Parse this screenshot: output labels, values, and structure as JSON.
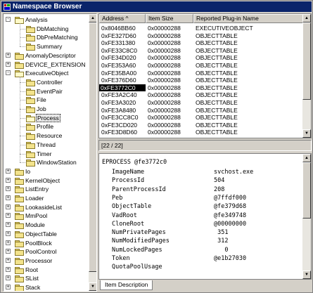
{
  "window": {
    "title": "Namespace Browser"
  },
  "tree": {
    "items": [
      {
        "label": "Analysis",
        "depth": 0,
        "expander": "-",
        "icon": "folder-open"
      },
      {
        "label": "DbMatching",
        "depth": 1,
        "expander": "",
        "icon": "folder"
      },
      {
        "label": "DbPreMatching",
        "depth": 1,
        "expander": "",
        "icon": "folder"
      },
      {
        "label": "Summary",
        "depth": 1,
        "expander": "",
        "icon": "folder"
      },
      {
        "label": "AnomalyDescriptor",
        "depth": 0,
        "expander": "+",
        "icon": "folder"
      },
      {
        "label": "DEVICE_EXTENSION",
        "depth": 0,
        "expander": "+",
        "icon": "folder"
      },
      {
        "label": "ExecutiveObject",
        "depth": 0,
        "expander": "-",
        "icon": "folder-open"
      },
      {
        "label": "Controller",
        "depth": 1,
        "expander": "",
        "icon": "folder"
      },
      {
        "label": "EventPair",
        "depth": 1,
        "expander": "",
        "icon": "folder"
      },
      {
        "label": "File",
        "depth": 1,
        "expander": "",
        "icon": "folder"
      },
      {
        "label": "Job",
        "depth": 1,
        "expander": "",
        "icon": "folder"
      },
      {
        "label": "Process",
        "depth": 1,
        "expander": "",
        "icon": "folder-open",
        "selected": true
      },
      {
        "label": "Profile",
        "depth": 1,
        "expander": "",
        "icon": "folder"
      },
      {
        "label": "Resource",
        "depth": 1,
        "expander": "",
        "icon": "folder"
      },
      {
        "label": "Thread",
        "depth": 1,
        "expander": "",
        "icon": "folder"
      },
      {
        "label": "Timer",
        "depth": 1,
        "expander": "",
        "icon": "folder"
      },
      {
        "label": "WindowStation",
        "depth": 1,
        "expander": "",
        "icon": "folder"
      },
      {
        "label": "Io",
        "depth": 0,
        "expander": "+",
        "icon": "folder"
      },
      {
        "label": "KernelObject",
        "depth": 0,
        "expander": "+",
        "icon": "folder"
      },
      {
        "label": "ListEntry",
        "depth": 0,
        "expander": "+",
        "icon": "folder"
      },
      {
        "label": "Loader",
        "depth": 0,
        "expander": "+",
        "icon": "folder"
      },
      {
        "label": "LookasideList",
        "depth": 0,
        "expander": "+",
        "icon": "folder"
      },
      {
        "label": "MmPool",
        "depth": 0,
        "expander": "+",
        "icon": "folder"
      },
      {
        "label": "Module",
        "depth": 0,
        "expander": "+",
        "icon": "folder"
      },
      {
        "label": "ObjectTable",
        "depth": 0,
        "expander": "+",
        "icon": "folder"
      },
      {
        "label": "PoolBlock",
        "depth": 0,
        "expander": "+",
        "icon": "folder"
      },
      {
        "label": "PoolControl",
        "depth": 0,
        "expander": "+",
        "icon": "folder"
      },
      {
        "label": "Processor",
        "depth": 0,
        "expander": "+",
        "icon": "folder"
      },
      {
        "label": "Root",
        "depth": 0,
        "expander": "+",
        "icon": "folder"
      },
      {
        "label": "SList",
        "depth": 0,
        "expander": "+",
        "icon": "folder"
      },
      {
        "label": "Stack",
        "depth": 0,
        "expander": "+",
        "icon": "folder"
      }
    ]
  },
  "list": {
    "columns": [
      "Address  ^",
      "Item Size",
      "Reported Plug-in Name"
    ],
    "rows": [
      [
        "0x8046BB60",
        "0x00000288",
        "EXECUTIVEOBJECT"
      ],
      [
        "0xFE327D60",
        "0x00000288",
        "OBJECTTABLE"
      ],
      [
        "0xFE331380",
        "0x00000288",
        "OBJECTTABLE"
      ],
      [
        "0xFE33C8C0",
        "0x00000288",
        "OBJECTTABLE"
      ],
      [
        "0xFE34D020",
        "0x00000288",
        "OBJECTTABLE"
      ],
      [
        "0xFE353A60",
        "0x00000288",
        "OBJECTTABLE"
      ],
      [
        "0xFE35BA00",
        "0x00000288",
        "OBJECTTABLE"
      ],
      [
        "0xFE376D60",
        "0x00000288",
        "OBJECTTABLE"
      ],
      [
        "0xFE3772C0",
        "0x00000288",
        "OBJECTTABLE"
      ],
      [
        "0xFE3A2C40",
        "0x00000288",
        "OBJECTTABLE"
      ],
      [
        "0xFE3A3020",
        "0x00000288",
        "OBJECTTABLE"
      ],
      [
        "0xFE3A8480",
        "0x00000288",
        "OBJECTTABLE"
      ],
      [
        "0xFE3CC8C0",
        "0x00000288",
        "OBJECTTABLE"
      ],
      [
        "0xFE3CD020",
        "0x00000288",
        "OBJECTTABLE"
      ],
      [
        "0xFE3D8D60",
        "0x00000288",
        "OBJECTTABLE"
      ]
    ],
    "selected_index": 8
  },
  "status": {
    "text": "[22 / 22]"
  },
  "detail": {
    "header": "EPROCESS @fe3772c0",
    "fields": [
      [
        "ImageName",
        "svchost.exe"
      ],
      [
        "ProcessId",
        "504"
      ],
      [
        "ParentProcessId",
        "208"
      ],
      [
        "Peb",
        "@7ffdf000"
      ],
      [
        "ObjectTable",
        "@fe379d68"
      ],
      [
        "VadRoot",
        "@fe349748"
      ],
      [
        "CloneRoot",
        "@00000000"
      ],
      [
        "NumPrivatePages",
        " 351"
      ],
      [
        "NumModifiedPages",
        " 312"
      ],
      [
        "NumLockedPages",
        "   0"
      ],
      [
        "Token",
        "@e1b27030"
      ],
      [
        "QuotaPoolUsage",
        ""
      ]
    ]
  },
  "tabs": {
    "item_description": "Item Description"
  }
}
